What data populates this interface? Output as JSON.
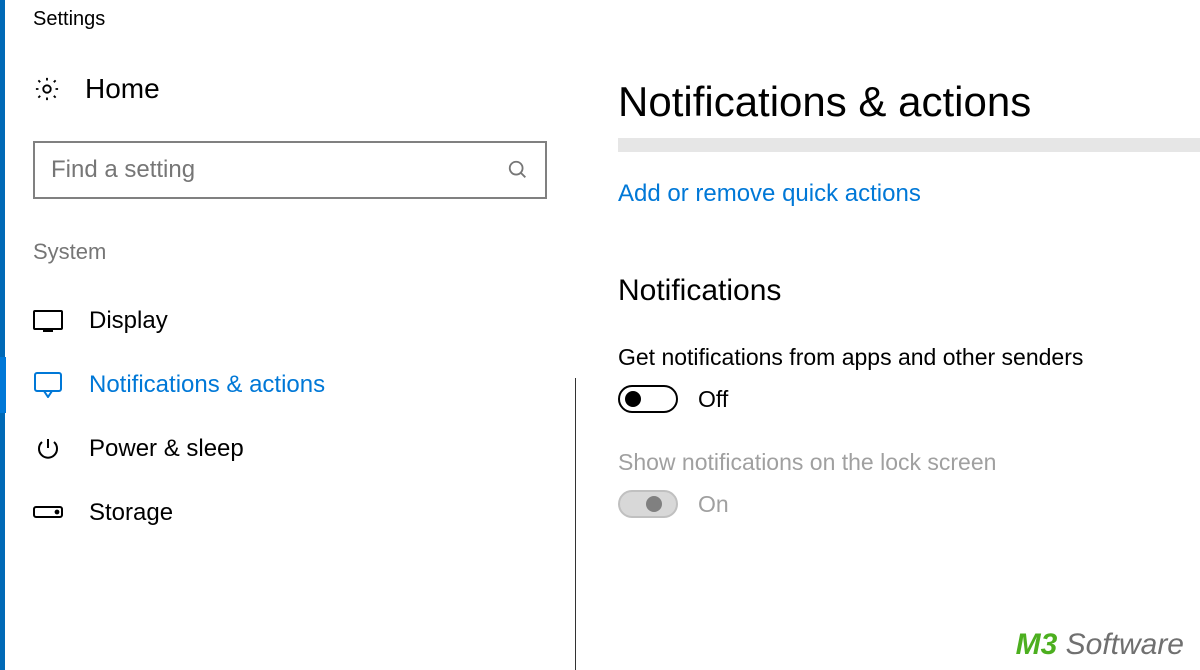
{
  "window_title": "Settings",
  "sidebar": {
    "home_label": "Home",
    "search_placeholder": "Find a setting",
    "section_label": "System",
    "items": [
      {
        "id": "display",
        "label": "Display",
        "active": false
      },
      {
        "id": "notifications",
        "label": "Notifications & actions",
        "active": true
      },
      {
        "id": "power",
        "label": "Power & sleep",
        "active": false
      },
      {
        "id": "storage",
        "label": "Storage",
        "active": false
      }
    ]
  },
  "main": {
    "page_title": "Notifications & actions",
    "quick_actions_link": "Add or remove quick actions",
    "notifications_heading": "Notifications",
    "settings": [
      {
        "label": "Get notifications from apps and other senders",
        "state": "Off",
        "disabled": false
      },
      {
        "label": "Show notifications on the lock screen",
        "state": "On",
        "disabled": true
      }
    ]
  },
  "watermark": {
    "left": "M3",
    "right": " Software"
  }
}
